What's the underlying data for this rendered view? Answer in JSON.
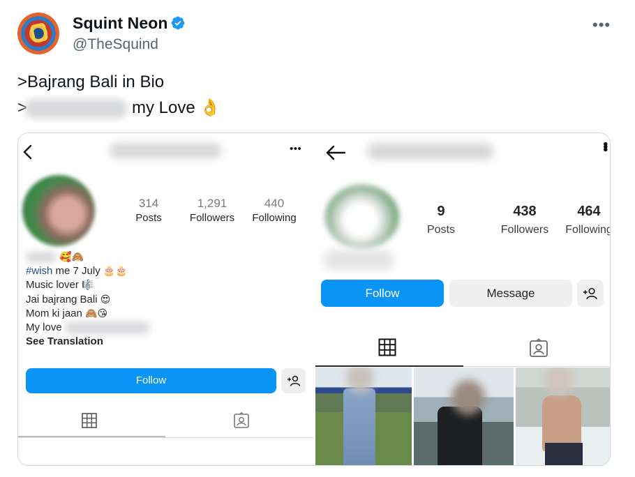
{
  "tweet": {
    "display_name": "Squint Neon",
    "handle": "@TheSquind",
    "line1": ">Bajrang Bali in Bio",
    "line2_prefix": ">",
    "line2_suffix": "my Love",
    "line2_emoji": "👌"
  },
  "left_profile": {
    "stats": [
      {
        "value": "314",
        "label": "Posts"
      },
      {
        "value": "1,291",
        "label": "Followers"
      },
      {
        "value": "440",
        "label": "Following"
      }
    ],
    "bio_line1_emoji": "🥰🙈",
    "bio_tag": "#wish",
    "bio_line2_rest": " me 7 July ",
    "bio_line2_emoji": "🎂🎂",
    "bio_line3": "Music lover ",
    "bio_line3_emoji": "🎼",
    "bio_line4": "Jai bajrang Bali ",
    "bio_line4_emoji": "😍",
    "bio_line5": "Mom ki jaan ",
    "bio_line5_emoji": "🙈😘",
    "bio_line6": "My love",
    "see_translation": "See Translation",
    "follow_label": "Follow"
  },
  "right_profile": {
    "stats": [
      {
        "value": "9",
        "label": "Posts"
      },
      {
        "value": "438",
        "label": "Followers"
      },
      {
        "value": "464",
        "label": "Following"
      }
    ],
    "follow_label": "Follow",
    "message_label": "Message"
  },
  "colors": {
    "follow_blue": "#0a95f6",
    "verified_blue": "#1d9bf0",
    "hashtag": "#1b4f8a"
  }
}
